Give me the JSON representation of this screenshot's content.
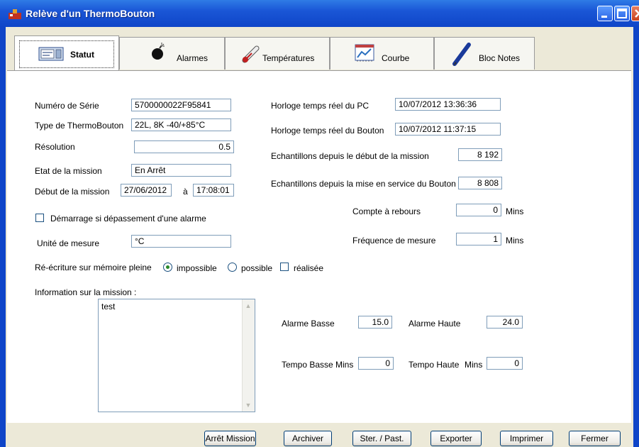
{
  "window": {
    "title": "Relève d'un ThermoBouton"
  },
  "tabs": [
    {
      "label": "Statut",
      "icon": "status-panel-icon"
    },
    {
      "label": "Alarmes",
      "icon": "bomb-icon"
    },
    {
      "label": "Températures",
      "icon": "thermometer-icon"
    },
    {
      "label": "Courbe",
      "icon": "chart-icon"
    },
    {
      "label": "Bloc Notes",
      "icon": "pen-icon"
    }
  ],
  "left": {
    "serial_label": "Numéro de Série",
    "serial_value": "5700000022F95841",
    "type_label": "Type de ThermoBouton",
    "type_value": "22L, 8K -40/+85°C",
    "resolution_label": "Résolution",
    "resolution_value": "0.5",
    "state_label": "Etat de la mission",
    "state_value": "En Arrêt",
    "start_label": "Début de la mission",
    "start_date": "27/06/2012",
    "start_at": "à",
    "start_time": "17:08:01",
    "alarm_start_label": "Démarrage si dépassement d'une alarme",
    "unit_label": "Unité de mesure",
    "unit_value": "°C"
  },
  "right": {
    "pc_clock_label": "Horloge temps réel du PC",
    "pc_clock_value": "10/07/2012 13:36:36",
    "btn_clock_label": "Horloge temps réel du Bouton",
    "btn_clock_value": "10/07/2012 11:37:15",
    "samples_mission_label": "Echantillons depuis le début de la mission",
    "samples_mission_value": "8 192",
    "samples_service_label": "Echantillons depuis la mise en service du Bouton",
    "samples_service_value": "8 808",
    "countdown_label": "Compte à rebours",
    "countdown_value": "0",
    "countdown_unit": "Mins",
    "freq_label": "Fréquence de mesure",
    "freq_value": "1",
    "freq_unit": "Mins"
  },
  "rewrite": {
    "label": "Ré-écriture sur mémoire pleine",
    "opt_impossible": "impossible",
    "opt_possible": "possible",
    "opt_done": "réalisée"
  },
  "info": {
    "label": "Information sur la mission :",
    "text": "test"
  },
  "alarms": {
    "low_label": "Alarme Basse",
    "low_value": "15.0",
    "high_label": "Alarme Haute",
    "high_value": "24.0",
    "tempo_low_label": "Tempo Basse",
    "tempo_low_unit": "Mins",
    "tempo_low_value": "0",
    "tempo_high_label": "Tempo Haute",
    "tempo_high_unit": "Mins",
    "tempo_high_value": "0"
  },
  "buttons": {
    "stop": "Arrêt Mission",
    "archive": "Archiver",
    "save": "Ster. / Past.",
    "export": "Exporter",
    "print": "Imprimer",
    "close": "Fermer"
  }
}
